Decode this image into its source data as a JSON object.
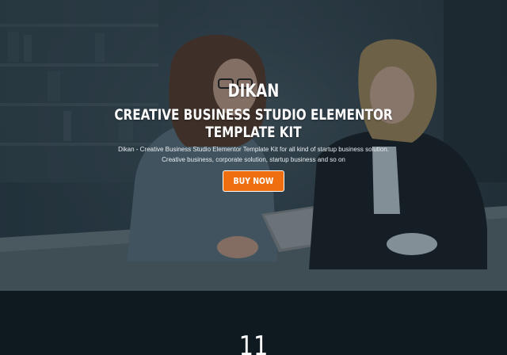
{
  "hero": {
    "brand": "DIKAN",
    "headline": "CREATIVE BUSINESS STUDIO ELEMENTOR TEMPLATE KIT",
    "subtext": "Dikan - Creative Business Studio Elementor Template Kit for all kind of startup business solution. Creative business, corporate solution, startup business and so on",
    "button_label": "BUY NOW",
    "accent_color": "#ef6f10",
    "photo": "two-women-reviewing-tablet-in-office"
  },
  "stats": {
    "counter_value": "11"
  }
}
